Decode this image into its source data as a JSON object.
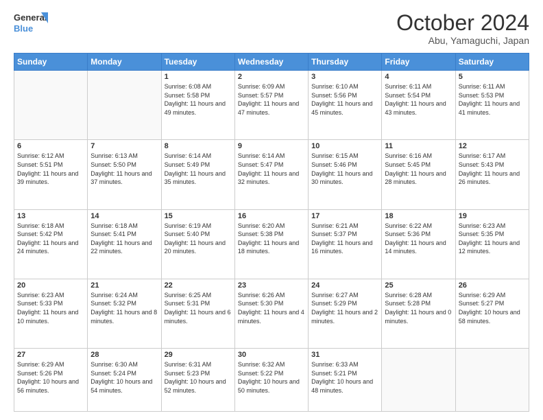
{
  "logo": {
    "line1": "General",
    "line2": "Blue"
  },
  "header": {
    "month": "October 2024",
    "location": "Abu, Yamaguchi, Japan"
  },
  "weekdays": [
    "Sunday",
    "Monday",
    "Tuesday",
    "Wednesday",
    "Thursday",
    "Friday",
    "Saturday"
  ],
  "weeks": [
    [
      {
        "day": "",
        "info": ""
      },
      {
        "day": "",
        "info": ""
      },
      {
        "day": "1",
        "info": "Sunrise: 6:08 AM\nSunset: 5:58 PM\nDaylight: 11 hours and 49 minutes."
      },
      {
        "day": "2",
        "info": "Sunrise: 6:09 AM\nSunset: 5:57 PM\nDaylight: 11 hours and 47 minutes."
      },
      {
        "day": "3",
        "info": "Sunrise: 6:10 AM\nSunset: 5:56 PM\nDaylight: 11 hours and 45 minutes."
      },
      {
        "day": "4",
        "info": "Sunrise: 6:11 AM\nSunset: 5:54 PM\nDaylight: 11 hours and 43 minutes."
      },
      {
        "day": "5",
        "info": "Sunrise: 6:11 AM\nSunset: 5:53 PM\nDaylight: 11 hours and 41 minutes."
      }
    ],
    [
      {
        "day": "6",
        "info": "Sunrise: 6:12 AM\nSunset: 5:51 PM\nDaylight: 11 hours and 39 minutes."
      },
      {
        "day": "7",
        "info": "Sunrise: 6:13 AM\nSunset: 5:50 PM\nDaylight: 11 hours and 37 minutes."
      },
      {
        "day": "8",
        "info": "Sunrise: 6:14 AM\nSunset: 5:49 PM\nDaylight: 11 hours and 35 minutes."
      },
      {
        "day": "9",
        "info": "Sunrise: 6:14 AM\nSunset: 5:47 PM\nDaylight: 11 hours and 32 minutes."
      },
      {
        "day": "10",
        "info": "Sunrise: 6:15 AM\nSunset: 5:46 PM\nDaylight: 11 hours and 30 minutes."
      },
      {
        "day": "11",
        "info": "Sunrise: 6:16 AM\nSunset: 5:45 PM\nDaylight: 11 hours and 28 minutes."
      },
      {
        "day": "12",
        "info": "Sunrise: 6:17 AM\nSunset: 5:43 PM\nDaylight: 11 hours and 26 minutes."
      }
    ],
    [
      {
        "day": "13",
        "info": "Sunrise: 6:18 AM\nSunset: 5:42 PM\nDaylight: 11 hours and 24 minutes."
      },
      {
        "day": "14",
        "info": "Sunrise: 6:18 AM\nSunset: 5:41 PM\nDaylight: 11 hours and 22 minutes."
      },
      {
        "day": "15",
        "info": "Sunrise: 6:19 AM\nSunset: 5:40 PM\nDaylight: 11 hours and 20 minutes."
      },
      {
        "day": "16",
        "info": "Sunrise: 6:20 AM\nSunset: 5:38 PM\nDaylight: 11 hours and 18 minutes."
      },
      {
        "day": "17",
        "info": "Sunrise: 6:21 AM\nSunset: 5:37 PM\nDaylight: 11 hours and 16 minutes."
      },
      {
        "day": "18",
        "info": "Sunrise: 6:22 AM\nSunset: 5:36 PM\nDaylight: 11 hours and 14 minutes."
      },
      {
        "day": "19",
        "info": "Sunrise: 6:23 AM\nSunset: 5:35 PM\nDaylight: 11 hours and 12 minutes."
      }
    ],
    [
      {
        "day": "20",
        "info": "Sunrise: 6:23 AM\nSunset: 5:33 PM\nDaylight: 11 hours and 10 minutes."
      },
      {
        "day": "21",
        "info": "Sunrise: 6:24 AM\nSunset: 5:32 PM\nDaylight: 11 hours and 8 minutes."
      },
      {
        "day": "22",
        "info": "Sunrise: 6:25 AM\nSunset: 5:31 PM\nDaylight: 11 hours and 6 minutes."
      },
      {
        "day": "23",
        "info": "Sunrise: 6:26 AM\nSunset: 5:30 PM\nDaylight: 11 hours and 4 minutes."
      },
      {
        "day": "24",
        "info": "Sunrise: 6:27 AM\nSunset: 5:29 PM\nDaylight: 11 hours and 2 minutes."
      },
      {
        "day": "25",
        "info": "Sunrise: 6:28 AM\nSunset: 5:28 PM\nDaylight: 11 hours and 0 minutes."
      },
      {
        "day": "26",
        "info": "Sunrise: 6:29 AM\nSunset: 5:27 PM\nDaylight: 10 hours and 58 minutes."
      }
    ],
    [
      {
        "day": "27",
        "info": "Sunrise: 6:29 AM\nSunset: 5:26 PM\nDaylight: 10 hours and 56 minutes."
      },
      {
        "day": "28",
        "info": "Sunrise: 6:30 AM\nSunset: 5:24 PM\nDaylight: 10 hours and 54 minutes."
      },
      {
        "day": "29",
        "info": "Sunrise: 6:31 AM\nSunset: 5:23 PM\nDaylight: 10 hours and 52 minutes."
      },
      {
        "day": "30",
        "info": "Sunrise: 6:32 AM\nSunset: 5:22 PM\nDaylight: 10 hours and 50 minutes."
      },
      {
        "day": "31",
        "info": "Sunrise: 6:33 AM\nSunset: 5:21 PM\nDaylight: 10 hours and 48 minutes."
      },
      {
        "day": "",
        "info": ""
      },
      {
        "day": "",
        "info": ""
      }
    ]
  ]
}
